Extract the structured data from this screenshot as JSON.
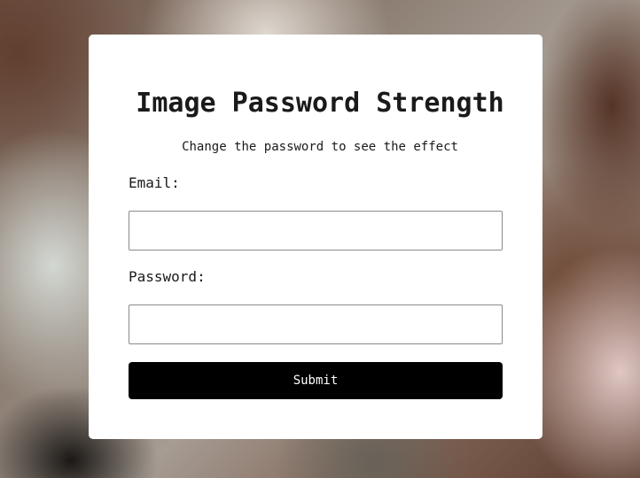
{
  "form": {
    "title": "Image Password Strength",
    "subtitle": "Change the password to see the effect",
    "email_label": "Email:",
    "email_value": "",
    "email_placeholder": "",
    "password_label": "Password:",
    "password_value": "",
    "password_placeholder": "",
    "submit_label": "Submit"
  },
  "colors": {
    "card_background": "#ffffff",
    "button_background": "#000000",
    "button_text": "#ffffff",
    "text": "#1a1a1a"
  }
}
